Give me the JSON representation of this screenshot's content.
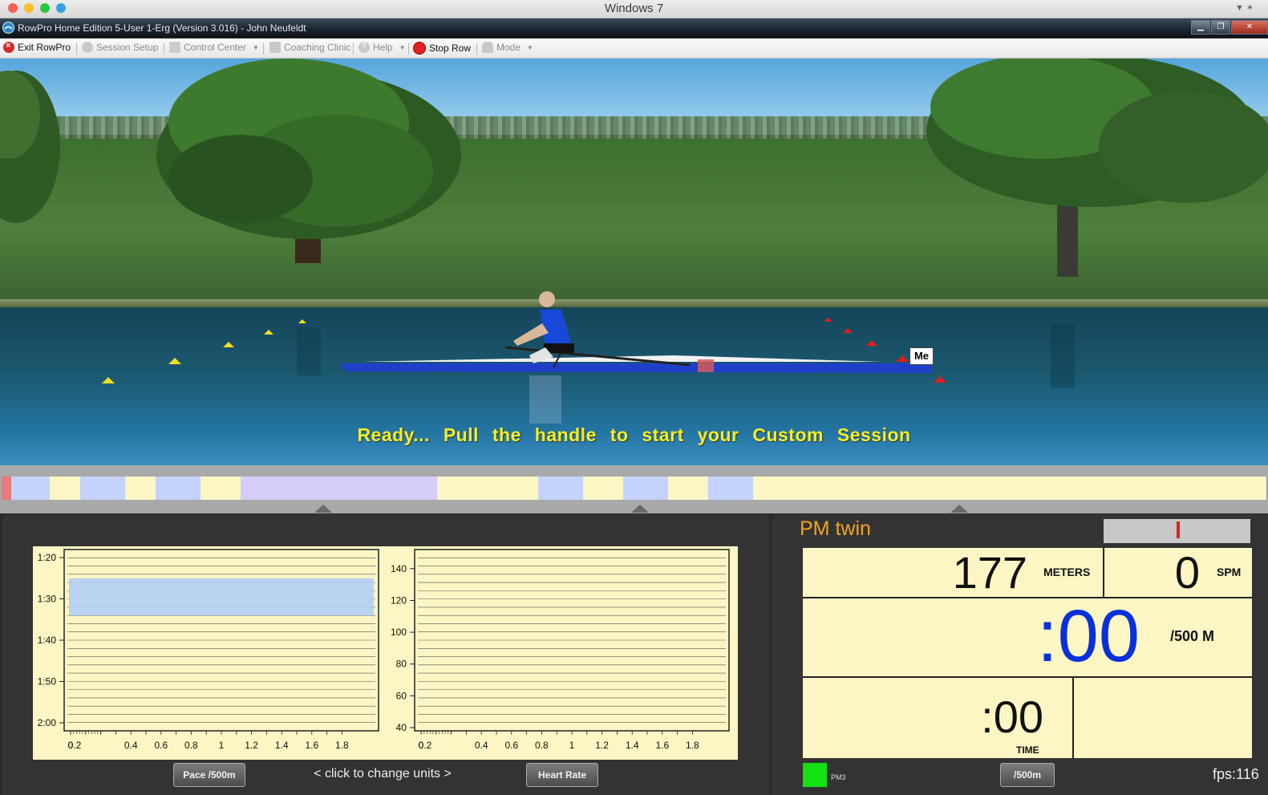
{
  "mac": {
    "title": "Windows 7"
  },
  "window": {
    "title": "RowPro Home Edition 5-User 1-Erg  (Version 3.016) - John Neufeldt"
  },
  "toolbar": {
    "exit": "Exit RowPro",
    "session_setup": "Session Setup",
    "control_center": "Control Center",
    "coaching_clinic": "Coaching Clinic",
    "help": "Help",
    "stop_row": "Stop Row",
    "mode": "Mode"
  },
  "scene": {
    "message": "Ready... Pull the handle to start your Custom Session",
    "me_label": "Me"
  },
  "timeline": {
    "segments": [
      "#e47c7c",
      "#c4d3fb",
      "#fbf6c4",
      "#c4d3fb",
      "#fbf6c4",
      "#c4d3fb",
      "#fbf6c4",
      "#d6ccf8",
      "#fbf6c4",
      "#c4d3fb",
      "#fbf6c4",
      "#c4d3fb",
      "#fbf6c4",
      "#c4d3fb",
      "#fbf6c4"
    ]
  },
  "graphs": {
    "pace_button": "Pace /500m",
    "hr_button": "Heart Rate",
    "units_hint": "<  click to change units  >"
  },
  "chart_data": [
    {
      "type": "line",
      "title": "",
      "ylabel": "Pace /500m",
      "y_ticks": [
        "1:20",
        "1:30",
        "1:40",
        "1:50",
        "2:00"
      ],
      "x_ticks": [
        "0.2",
        "0.4",
        "0.6",
        "0.8",
        "1",
        "1.2",
        "1.4",
        "1.6",
        "1.8"
      ],
      "x_first_labels": [
        "0",
        "0.2"
      ],
      "target_band": [
        "1:25",
        "1:34"
      ],
      "series": []
    },
    {
      "type": "line",
      "title": "",
      "ylabel": "Heart Rate",
      "y_ticks": [
        "140",
        "120",
        "100",
        "80",
        "60",
        "40"
      ],
      "ylim": [
        40,
        150
      ],
      "x_ticks": [
        "0.2",
        "0.4",
        "0.6",
        "0.8",
        "1",
        "1.2",
        "1.4",
        "1.6",
        "1.8"
      ],
      "x_first_labels": [
        "0",
        "0.2"
      ],
      "series": []
    }
  ],
  "pm": {
    "title": "PM twin",
    "meters": "177",
    "meters_unit": "METERS",
    "spm": "0",
    "spm_unit": "SPM",
    "pace": ":00",
    "pace_unit": "/500 M",
    "time": ":00",
    "time_unit": "TIME",
    "green_label": "PM3",
    "units_button": "/500m",
    "fps": "fps:116"
  },
  "colors": {
    "pace_blue": "#0a30dc",
    "pm_title": "#f2a41e",
    "message": "#f2ef2a"
  }
}
